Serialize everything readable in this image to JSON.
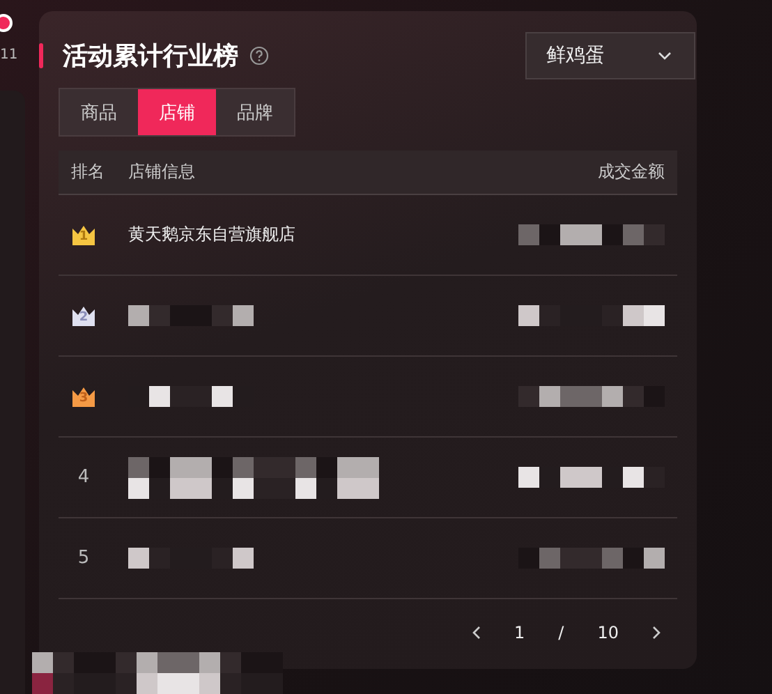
{
  "side_label": "11",
  "title": "活动累计行业榜",
  "dropdown": {
    "value": "鲜鸡蛋"
  },
  "tabs": [
    {
      "label": "商品",
      "selected": false
    },
    {
      "label": "店铺",
      "selected": true
    },
    {
      "label": "品牌",
      "selected": false
    }
  ],
  "table": {
    "columns": [
      "排名",
      "店铺信息",
      "成交金额"
    ],
    "rows": [
      {
        "kind": "crown",
        "rank": "1",
        "color": "#f5c542",
        "shop": "黄天鹅京东自营旗舰店",
        "shop_pixelated": false
      },
      {
        "kind": "crown",
        "rank": "2",
        "color": "#dfe0f0",
        "shop_pixelated": true
      },
      {
        "kind": "crown",
        "rank": "3",
        "color": "#f59a45",
        "shop_pixelated": true
      },
      {
        "kind": "number",
        "rank": "4",
        "shop_pixelated": true
      },
      {
        "kind": "number",
        "rank": "5",
        "shop_pixelated": true
      }
    ]
  },
  "pagination": {
    "page": "1",
    "separator": "/",
    "total": "10"
  }
}
